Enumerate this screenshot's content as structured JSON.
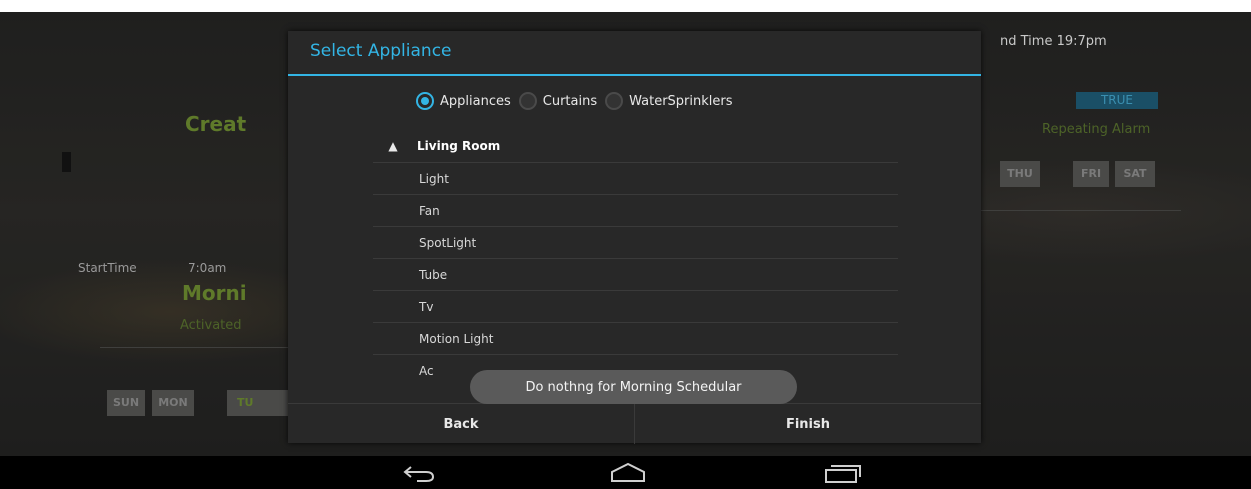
{
  "background": {
    "create_title": "Creat",
    "start_time_label": "StartTime",
    "start_time_value": "7:0am",
    "schedule_title": "Morni",
    "status": "Activated",
    "end_time": "nd Time  19:7pm",
    "true_badge": "TRUE",
    "repeat_label": "Repeating Alarm",
    "days_left": [
      "SUN",
      "MON",
      "TU"
    ],
    "days_right": [
      "THU",
      "FRI",
      "SAT"
    ]
  },
  "dialog": {
    "title": "Select Appliance",
    "radio_options": [
      {
        "label": "Appliances",
        "checked": true
      },
      {
        "label": "Curtains",
        "checked": false
      },
      {
        "label": "WaterSprinklers",
        "checked": false
      }
    ],
    "group": {
      "label": "Living Room",
      "expanded": true
    },
    "items": [
      "Light",
      "Fan",
      "SpotLight",
      "Tube",
      "Tv",
      "Motion Light",
      "Ac"
    ],
    "back_label": "Back",
    "finish_label": "Finish"
  },
  "toast": "Do nothng for  Morning Schedular",
  "navbar": {
    "icons": [
      "back-icon",
      "home-icon",
      "recents-icon"
    ]
  },
  "colors": {
    "accent": "#33b5e5",
    "green": "#5f7a2a",
    "dialog_bg": "#282828"
  }
}
